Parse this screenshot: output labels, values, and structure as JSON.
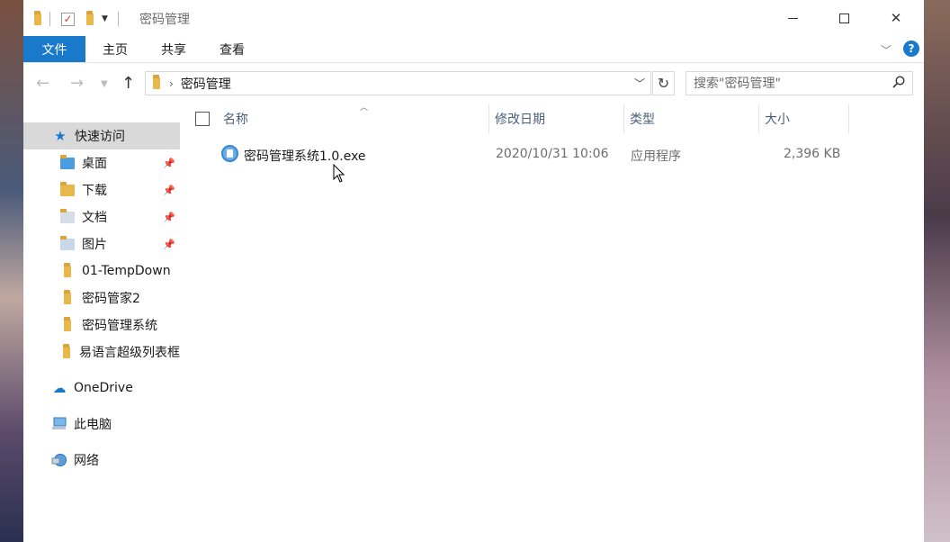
{
  "window": {
    "title": "密码管理",
    "accent_color": "#1979ca"
  },
  "ribbon": {
    "tabs": [
      "文件",
      "主页",
      "共享",
      "查看"
    ],
    "help_label": "?"
  },
  "navbar": {
    "breadcrumb": "密码管理",
    "search_placeholder": "搜索\"密码管理\""
  },
  "nav_pane": {
    "quick_access": "快速访问",
    "quick_items": [
      {
        "label": "桌面",
        "icon": "desktop-folder-icon",
        "pinned": true
      },
      {
        "label": "下载",
        "icon": "download-folder-icon",
        "pinned": true
      },
      {
        "label": "文档",
        "icon": "documents-folder-icon",
        "pinned": true
      },
      {
        "label": "图片",
        "icon": "pictures-folder-icon",
        "pinned": true
      },
      {
        "label": "01-TempDown",
        "icon": "folder-icon",
        "pinned": false
      },
      {
        "label": "密码管家2",
        "icon": "folder-icon",
        "pinned": false
      },
      {
        "label": "密码管理系统",
        "icon": "folder-icon",
        "pinned": false
      },
      {
        "label": "易语言超级列表框",
        "icon": "folder-icon",
        "pinned": false
      }
    ],
    "onedrive": "OneDrive",
    "this_pc": "此电脑",
    "network": "网络"
  },
  "file_list": {
    "columns": [
      "名称",
      "修改日期",
      "类型",
      "大小"
    ],
    "rows": [
      {
        "name": "密码管理系统1.0.exe",
        "modified": "2020/10/31 10:06",
        "type": "应用程序",
        "size": "2,396 KB"
      }
    ]
  }
}
